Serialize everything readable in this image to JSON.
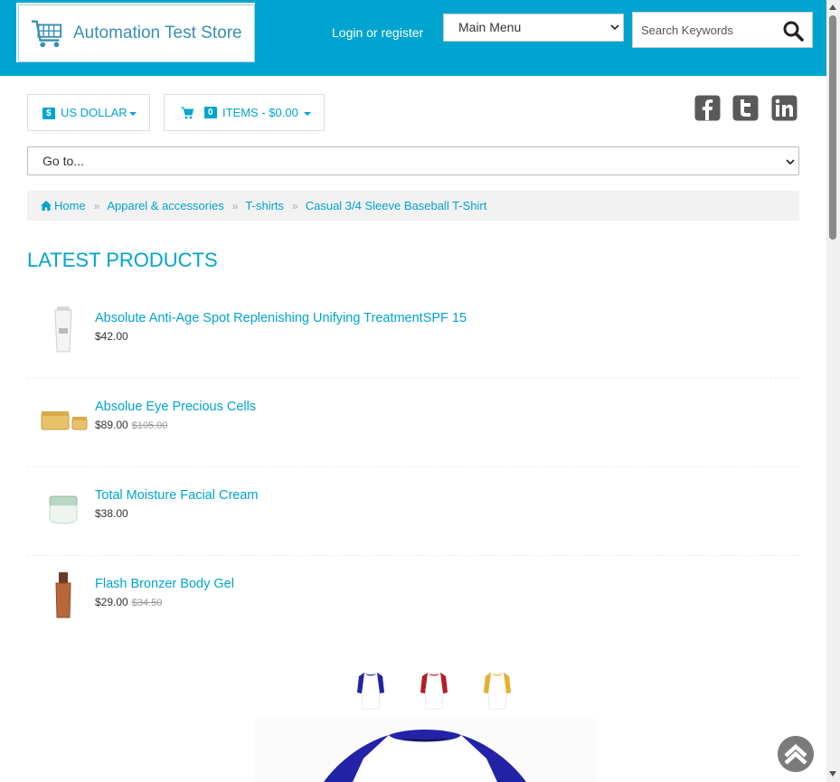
{
  "header": {
    "logo_text": "Automation Test Store",
    "login_label": "Login or register",
    "main_menu_value": "Main Menu",
    "search_placeholder": "Search Keywords"
  },
  "toolbar": {
    "currency_symbol": "$",
    "currency_label": "US DOLLAR",
    "cart_count": "0",
    "cart_label": "ITEMS - $0.00"
  },
  "social": [
    "facebook-icon",
    "twitter-icon",
    "linkedin-icon"
  ],
  "goto": {
    "value": "Go to..."
  },
  "breadcrumb": {
    "items": [
      "Home",
      "Apparel & accessories",
      "T-shirts",
      "Casual 3/4 Sleeve Baseball T-Shirt"
    ]
  },
  "latest": {
    "heading": "LATEST PRODUCTS",
    "products": [
      {
        "name": "Absolute Anti-Age Spot Replenishing Unifying TreatmentSPF 15",
        "price": "$42.00",
        "old_price": ""
      },
      {
        "name": "Absolue Eye Precious Cells",
        "price": "$89.00",
        "old_price": "$105.00"
      },
      {
        "name": "Total Moisture Facial Cream",
        "price": "$38.00",
        "old_price": ""
      },
      {
        "name": "Flash Bronzer Body Gel",
        "price": "$29.00",
        "old_price": "$34.50"
      }
    ]
  },
  "colors": {
    "brand": "#00a4d0",
    "variant_blue": "#2323a8",
    "variant_red": "#b51d24",
    "variant_yellow": "#e3b12a"
  }
}
